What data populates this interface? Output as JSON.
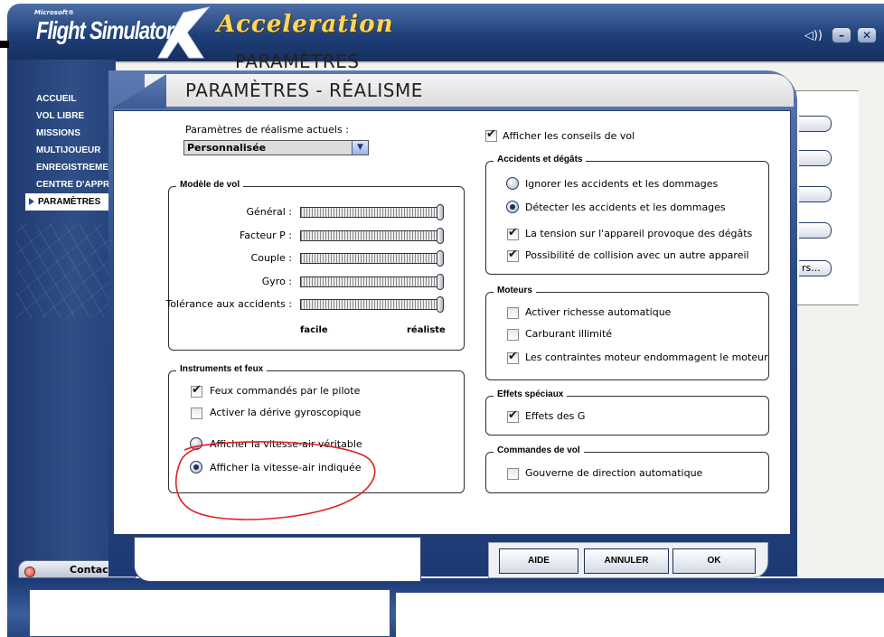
{
  "app": {
    "brand_small": "Microsoft®",
    "brand_name": "Flight Simulator",
    "brand_suffix": "Acceleration",
    "background_heading": "PARAMÈTRES",
    "window_controls": [
      "sound-icon",
      "minimize-icon",
      "close-icon"
    ],
    "background_buttons": [
      "",
      "",
      "",
      "",
      "rs..."
    ]
  },
  "sidebar": {
    "items": [
      {
        "label": "ACCUEIL",
        "active": false
      },
      {
        "label": "VOL LIBRE",
        "active": false
      },
      {
        "label": "MISSIONS",
        "active": false
      },
      {
        "label": "MULTIJOUEUR",
        "active": false
      },
      {
        "label": "ENREGISTREMENT",
        "active": false
      },
      {
        "label": "CENTRE D'APPRENTISSAGE",
        "active": false
      },
      {
        "label": "PARAMÈTRES",
        "active": true
      }
    ]
  },
  "contacts": {
    "label": "Contacts"
  },
  "dialog": {
    "title": "PARAMÈTRES - RÉALISME",
    "realism_label": "Paramètres de réalisme actuels :",
    "realism_value": "Personnalisée",
    "flight_model": {
      "title": "Modèle de vol",
      "sliders": [
        {
          "label": "Général :",
          "value": 1.0
        },
        {
          "label": "Facteur P :",
          "value": 1.0
        },
        {
          "label": "Couple :",
          "value": 1.0
        },
        {
          "label": "Gyro :",
          "value": 1.0
        },
        {
          "label": "Tolérance aux accidents :",
          "value": 1.0
        }
      ],
      "scale_min": "facile",
      "scale_max": "réaliste"
    },
    "instruments": {
      "title": "Instruments et feux",
      "checkboxes": [
        {
          "label": "Feux commandés par le pilote",
          "checked": true
        },
        {
          "label": "Activer la dérive gyroscopique",
          "checked": false
        }
      ],
      "radios": [
        {
          "label": "Afficher la vitesse-air véritable",
          "checked": false
        },
        {
          "label": "Afficher la vitesse-air indiquée",
          "checked": true
        }
      ]
    },
    "show_tips": {
      "label": "Afficher les conseils de vol",
      "checked": true
    },
    "crashes": {
      "title": "Accidents et dégâts",
      "radios": [
        {
          "label": "Ignorer les accidents et les dommages",
          "checked": false
        },
        {
          "label": "Détecter les accidents et les dommages",
          "checked": true
        }
      ],
      "checkboxes": [
        {
          "label": "La tension sur l'appareil provoque des dégâts",
          "checked": true
        },
        {
          "label": "Possibilité de collision avec un autre appareil",
          "checked": true
        }
      ]
    },
    "engines": {
      "title": "Moteurs",
      "checkboxes": [
        {
          "label": "Activer richesse automatique",
          "checked": false
        },
        {
          "label": "Carburant illimité",
          "checked": false
        },
        {
          "label": "Les contraintes moteur endommagent le moteur",
          "checked": true
        }
      ]
    },
    "special_effects": {
      "title": "Effets spéciaux",
      "checkboxes": [
        {
          "label": "Effets des G",
          "checked": true
        }
      ]
    },
    "flight_controls": {
      "title": "Commandes de vol",
      "checkboxes": [
        {
          "label": "Gouverne de direction automatique",
          "checked": false
        }
      ]
    },
    "buttons": {
      "help": "AIDE",
      "cancel": "ANNULER",
      "ok": "OK"
    },
    "annotation_color": "#e02020"
  }
}
